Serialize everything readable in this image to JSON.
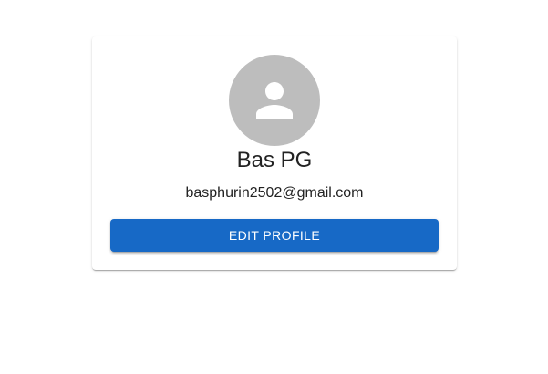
{
  "profile": {
    "avatar_icon": "person-icon",
    "name": "Bas PG",
    "email": "basphurin2502@gmail.com",
    "edit_label": "EDIT PROFILE"
  },
  "colors": {
    "avatar_bg": "#bdbdbd",
    "button_bg": "#1769c6",
    "button_text": "#ffffff"
  }
}
